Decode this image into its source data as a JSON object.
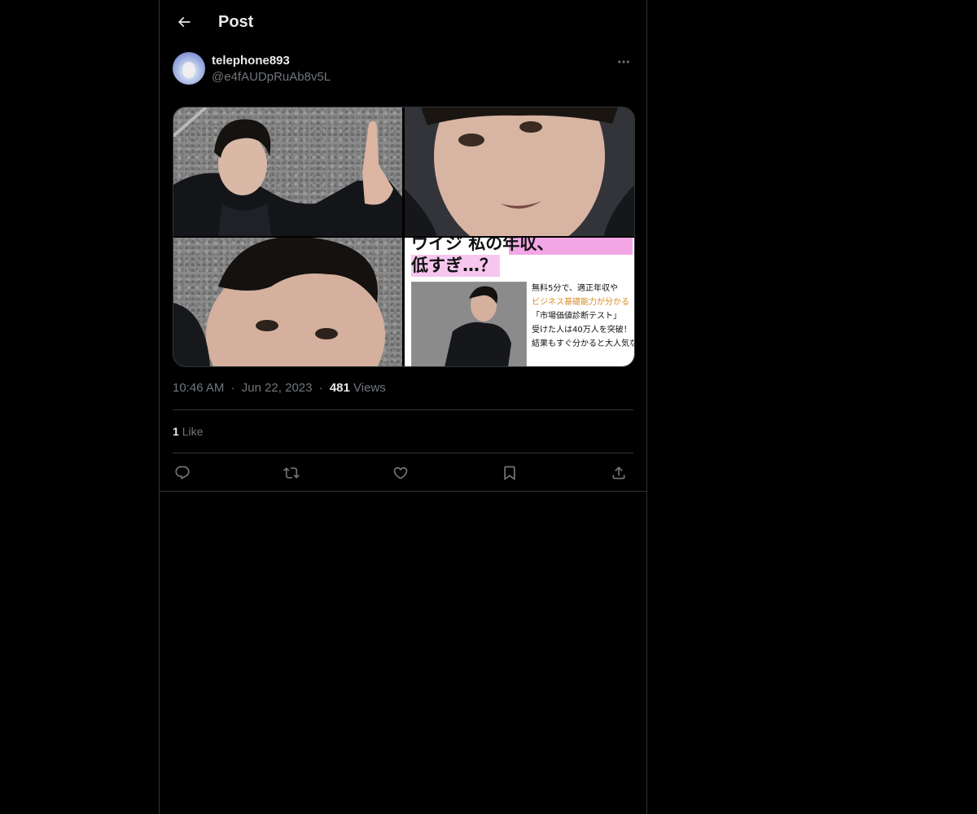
{
  "header": {
    "title": "Post",
    "back_icon": "arrow-left-icon"
  },
  "author": {
    "display_name": "telephone893",
    "handle": "@e4fAUDpRuAb8v5L",
    "avatar_icon": "avatar",
    "more_icon": "more-horizontal-icon"
  },
  "media": {
    "tile_count": 4,
    "ad_headline_line1": "ウイジ 私の年収、",
    "ad_headline_line2": "低すぎ…？",
    "ad_body_lines": [
      "無料5分で、適正年収や",
      "ビジネス基礎能力が分かる",
      "「市場価値診断テスト」",
      "受けた人は40万人を突破！",
      "結果もすぐ分かると大人気な"
    ],
    "accent_pink": "#f07ad9"
  },
  "meta": {
    "time": "10:46 AM",
    "separator": "·",
    "date": "Jun 22, 2023",
    "views_count": "481",
    "views_label": "Views"
  },
  "likes": {
    "count": "1",
    "label": "Like"
  },
  "actions": [
    {
      "name": "reply",
      "icon": "reply-icon"
    },
    {
      "name": "repost",
      "icon": "repost-icon"
    },
    {
      "name": "like",
      "icon": "heart-icon"
    },
    {
      "name": "bookmark",
      "icon": "bookmark-icon"
    },
    {
      "name": "share",
      "icon": "share-icon"
    }
  ],
  "colors": {
    "background": "#000000",
    "text_primary": "#e7e9ea",
    "text_secondary": "#71767b",
    "border": "#2f3336"
  }
}
